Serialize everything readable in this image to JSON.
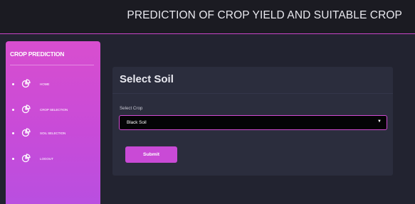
{
  "header": {
    "title": "PREDICTION OF CROP YIELD AND SUITABLE CROP"
  },
  "sidebar": {
    "brand": "CROP PREDICTION",
    "items": [
      {
        "label": "HOME",
        "icon": "pie-chart-icon"
      },
      {
        "label": "CROP SELECTION",
        "icon": "pie-chart-icon"
      },
      {
        "label": "SOIL SELECTION",
        "icon": "pie-chart-icon"
      },
      {
        "label": "LOGOUT",
        "icon": "pie-chart-icon"
      }
    ]
  },
  "main": {
    "heading": "Select Soil",
    "field_label": "Select Crop",
    "selected_value": "Black Soil",
    "submit_label": "Submit"
  },
  "colors": {
    "accent": "#c94ad6",
    "background": "#222330",
    "card": "#2b2d3d",
    "topbar": "#1b1b22"
  }
}
